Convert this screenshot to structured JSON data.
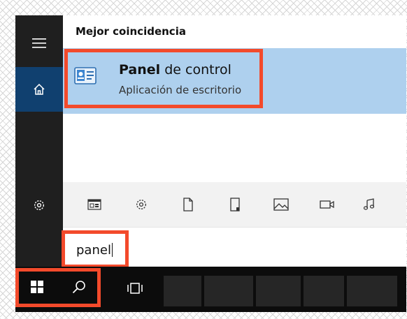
{
  "results": {
    "header": "Mejor coincidencia",
    "best": {
      "title_bold": "Panel",
      "title_rest": " de control",
      "subtitle": "Aplicación de escritorio"
    }
  },
  "search": {
    "value": "panel"
  },
  "left_rail": [
    "hamburger-menu-icon",
    "home-icon",
    "settings-gear-icon"
  ],
  "filters": [
    "apps-icon",
    "settings-icon",
    "document-icon",
    "folder-icon",
    "photo-icon",
    "video-icon",
    "music-icon"
  ],
  "taskbar": [
    "windows-start-icon",
    "search-icon",
    "task-view-icon"
  ],
  "colors": {
    "rail": "#1f1f1f",
    "home_selected": "#10406f",
    "result_highlight": "#aed0ee",
    "annotation": "#f34a2b",
    "taskbar": "#0c0c0c"
  }
}
